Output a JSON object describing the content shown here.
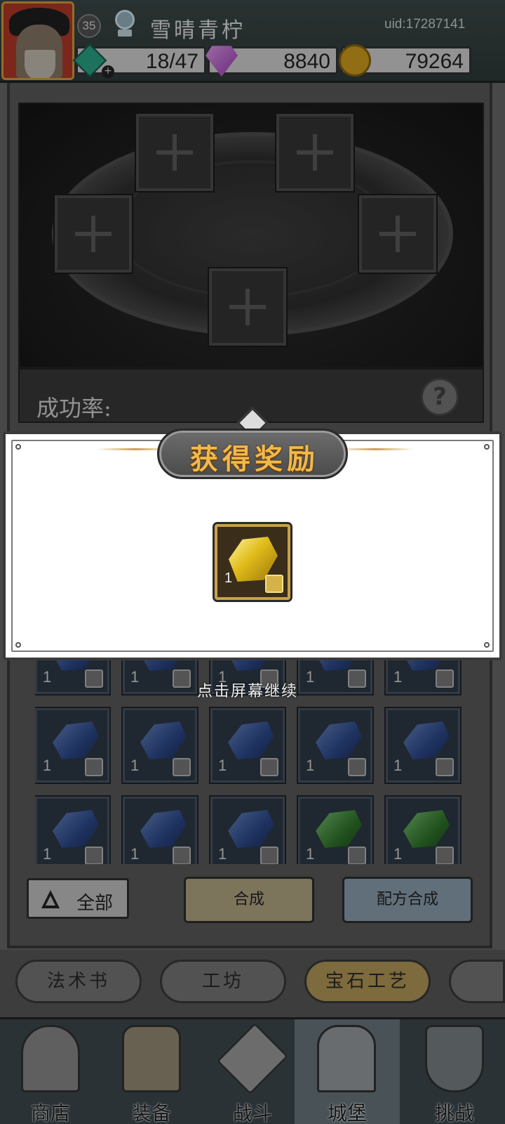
{
  "header": {
    "player_level": "35",
    "player_name": "雪晴青柠",
    "uid": "uid:17287141",
    "energy": "18/47",
    "gems": "8840",
    "gold": "79264"
  },
  "altar": {
    "success_rate_label": "成功率:",
    "help_symbol": "?"
  },
  "inventory": {
    "count_label": "1",
    "cells": [
      "blue",
      "blue",
      "blue",
      "blue",
      "blue",
      "blue",
      "blue",
      "blue",
      "blue",
      "blue",
      "blue",
      "blue",
      "blue",
      "green",
      "green"
    ]
  },
  "actions": {
    "filter_label": "全部",
    "craft_label": "合成",
    "recipe_label": "配方合成"
  },
  "tabs": [
    {
      "label": "法术书",
      "active": false
    },
    {
      "label": "工坊",
      "active": false
    },
    {
      "label": "宝石工艺",
      "active": true
    }
  ],
  "nav": [
    {
      "label": "商店"
    },
    {
      "label": "装备"
    },
    {
      "label": "战斗"
    },
    {
      "label": "城堡",
      "active": true
    },
    {
      "label": "挑战"
    }
  ],
  "reward_popup": {
    "title": "获得奖励",
    "item": {
      "name": "gold-gem",
      "count": "1"
    },
    "continue_hint": "点击屏幕继续"
  },
  "colors": {
    "gold_accent": "#c9a14a",
    "active_tab": "#b89d5a",
    "recipe_button": "#8fa4b4",
    "craft_button": "#b8ac88"
  }
}
